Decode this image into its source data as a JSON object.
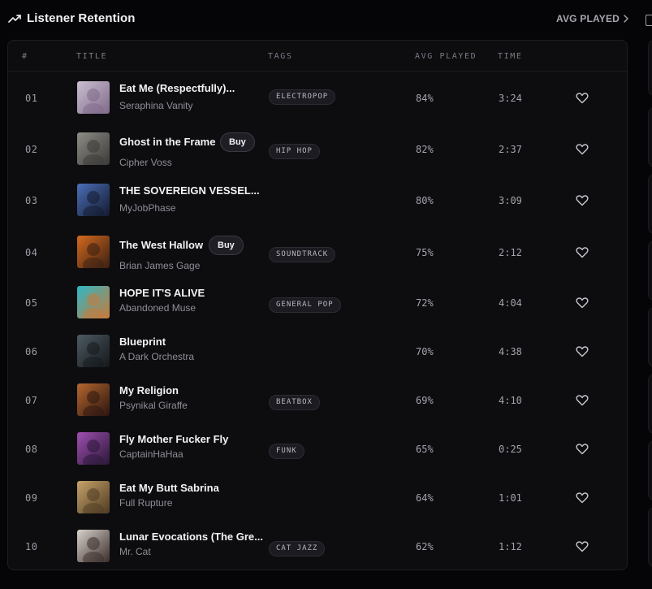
{
  "header": {
    "title": "Listener Retention",
    "icon": "trending-up-icon",
    "link_label": "AVG PLAYED",
    "link_icon": "chevron-right-icon"
  },
  "columns": {
    "index": "#",
    "title": "TITLE",
    "tags": "TAGS",
    "avg_played": "AVG PLAYED",
    "time": "TIME"
  },
  "tracks": [
    {
      "index": "01",
      "title": "Eat Me (Respectfully)...",
      "artist": "Seraphina Vanity",
      "tag": "ELECTROPOP",
      "avg_played": "84%",
      "time": "3:24",
      "buy": "",
      "colors": [
        "#cbbfd0",
        "#7f6a8a"
      ]
    },
    {
      "index": "02",
      "title": "Ghost in the Frame",
      "artist": "Cipher Voss",
      "tag": "HIP HOP",
      "avg_played": "82%",
      "time": "2:37",
      "buy": "Buy",
      "colors": [
        "#8e8c86",
        "#3b3a37"
      ]
    },
    {
      "index": "03",
      "title": "THE SOVEREIGN VESSEL...",
      "artist": "MyJobPhase",
      "tag": "",
      "avg_played": "80%",
      "time": "3:09",
      "buy": "",
      "colors": [
        "#4b6fb8",
        "#141a2e"
      ]
    },
    {
      "index": "04",
      "title": "The West Hallow",
      "artist": "Brian James Gage",
      "tag": "SOUNDTRACK",
      "avg_played": "75%",
      "time": "2:12",
      "buy": "Buy",
      "colors": [
        "#d46a1e",
        "#3a1f12"
      ]
    },
    {
      "index": "05",
      "title": "HOPE IT'S ALIVE",
      "artist": "Abandoned Muse",
      "tag": "GENERAL POP",
      "avg_played": "72%",
      "time": "4:04",
      "buy": "",
      "colors": [
        "#2fb7c6",
        "#c87a3a"
      ]
    },
    {
      "index": "06",
      "title": "Blueprint",
      "artist": "A Dark Orchestra",
      "tag": "",
      "avg_played": "70%",
      "time": "4:38",
      "buy": "",
      "colors": [
        "#4e5a62",
        "#14181b"
      ]
    },
    {
      "index": "07",
      "title": "My Religion",
      "artist": "Psynikal Giraffe",
      "tag": "BEATBOX",
      "avg_played": "69%",
      "time": "4:10",
      "buy": "",
      "colors": [
        "#b5672e",
        "#2b1510"
      ]
    },
    {
      "index": "08",
      "title": "Fly Mother Fucker Fly",
      "artist": "CaptainHaHaa",
      "tag": "FUNK",
      "avg_played": "65%",
      "time": "0:25",
      "buy": "",
      "colors": [
        "#a04fb0",
        "#2a1838"
      ]
    },
    {
      "index": "09",
      "title": "Eat My Butt Sabrina",
      "artist": "Full Rupture",
      "tag": "",
      "avg_played": "64%",
      "time": "1:01",
      "buy": "",
      "colors": [
        "#c7a36a",
        "#4e3b23"
      ]
    },
    {
      "index": "10",
      "title": "Lunar Evocations (The Gre...",
      "artist": "Mr. Cat",
      "tag": "CAT JAZZ",
      "avg_played": "62%",
      "time": "1:12",
      "buy": "",
      "colors": [
        "#d9d3cc",
        "#3a2e2a"
      ]
    }
  ],
  "colors": {
    "background": "#050507",
    "panel": "#0d0d10",
    "text_primary": "#f3f3f7",
    "text_secondary": "#8e8e98"
  }
}
